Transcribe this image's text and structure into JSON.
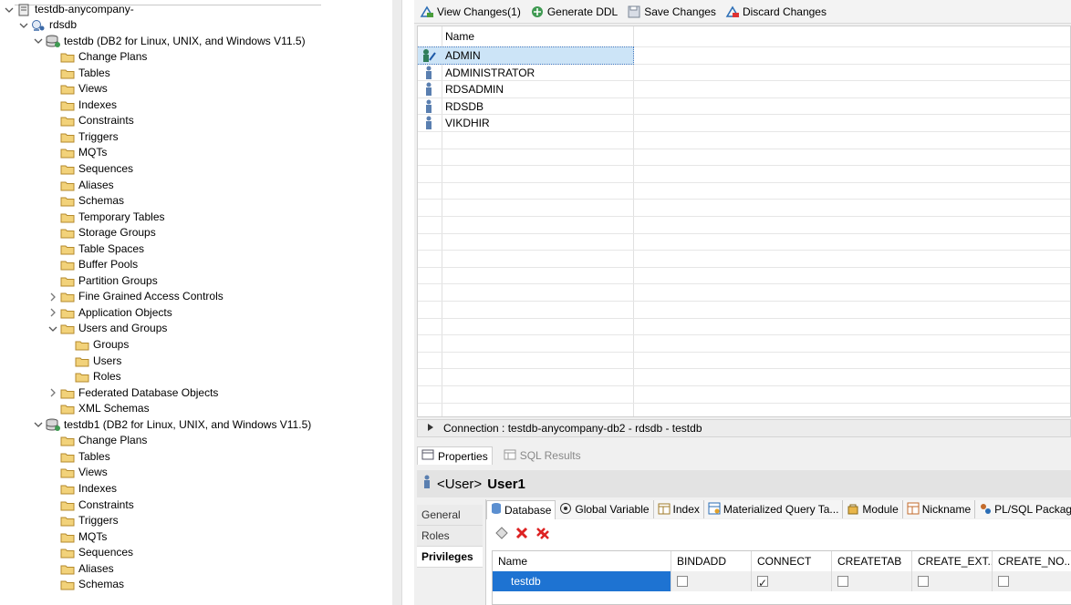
{
  "tree": {
    "nodes": [
      {
        "label": "testdb-anycompany-",
        "icon": "server-icon",
        "twisty": "open"
      },
      {
        "label": "rdsdb",
        "icon": "instance-icon",
        "twisty": "open"
      },
      {
        "label": "testdb (DB2 for Linux, UNIX, and Windows V11.5)",
        "icon": "database-icon",
        "twisty": "open"
      },
      {
        "label": "Change Plans",
        "icon": "folder-icon",
        "twisty": "none"
      },
      {
        "label": "Tables",
        "icon": "folder-icon",
        "twisty": "none"
      },
      {
        "label": "Views",
        "icon": "folder-icon",
        "twisty": "none"
      },
      {
        "label": "Indexes",
        "icon": "folder-icon",
        "twisty": "none"
      },
      {
        "label": "Constraints",
        "icon": "folder-icon",
        "twisty": "none"
      },
      {
        "label": "Triggers",
        "icon": "folder-icon",
        "twisty": "none"
      },
      {
        "label": "MQTs",
        "icon": "folder-icon",
        "twisty": "none"
      },
      {
        "label": "Sequences",
        "icon": "folder-icon",
        "twisty": "none"
      },
      {
        "label": "Aliases",
        "icon": "folder-icon",
        "twisty": "none"
      },
      {
        "label": "Schemas",
        "icon": "folder-icon",
        "twisty": "none"
      },
      {
        "label": "Temporary Tables",
        "icon": "folder-icon",
        "twisty": "none"
      },
      {
        "label": "Storage Groups",
        "icon": "folder-icon",
        "twisty": "none"
      },
      {
        "label": "Table Spaces",
        "icon": "folder-icon",
        "twisty": "none"
      },
      {
        "label": "Buffer Pools",
        "icon": "folder-icon",
        "twisty": "none"
      },
      {
        "label": "Partition Groups",
        "icon": "folder-icon",
        "twisty": "none"
      },
      {
        "label": "Fine Grained Access Controls",
        "icon": "folder-icon",
        "twisty": "closed"
      },
      {
        "label": "Application Objects",
        "icon": "folder-icon",
        "twisty": "closed"
      },
      {
        "label": "Users and Groups",
        "icon": "folder-icon",
        "twisty": "open"
      },
      {
        "label": "Groups",
        "icon": "folder-icon",
        "twisty": "none"
      },
      {
        "label": "Users",
        "icon": "folder-icon",
        "twisty": "none"
      },
      {
        "label": "Roles",
        "icon": "folder-icon",
        "twisty": "none"
      },
      {
        "label": "Federated Database Objects",
        "icon": "folder-icon",
        "twisty": "closed"
      },
      {
        "label": "XML Schemas",
        "icon": "folder-icon",
        "twisty": "none"
      },
      {
        "label": "testdb1 (DB2 for Linux, UNIX, and Windows V11.5)",
        "icon": "database-icon",
        "twisty": "open"
      },
      {
        "label": "Change Plans",
        "icon": "folder-icon",
        "twisty": "none"
      },
      {
        "label": "Tables",
        "icon": "folder-icon",
        "twisty": "none"
      },
      {
        "label": "Views",
        "icon": "folder-icon",
        "twisty": "none"
      },
      {
        "label": "Indexes",
        "icon": "folder-icon",
        "twisty": "none"
      },
      {
        "label": "Constraints",
        "icon": "folder-icon",
        "twisty": "none"
      },
      {
        "label": "Triggers",
        "icon": "folder-icon",
        "twisty": "none"
      },
      {
        "label": "MQTs",
        "icon": "folder-icon",
        "twisty": "none"
      },
      {
        "label": "Sequences",
        "icon": "folder-icon",
        "twisty": "none"
      },
      {
        "label": "Aliases",
        "icon": "folder-icon",
        "twisty": "none"
      },
      {
        "label": "Schemas",
        "icon": "folder-icon",
        "twisty": "none"
      }
    ]
  },
  "toolbar": {
    "view_changes": "View Changes(1)",
    "generate_ddl": "Generate DDL",
    "save_changes": "Save Changes",
    "discard_changes": "Discard Changes"
  },
  "users_grid": {
    "column_header": "Name",
    "rows": [
      {
        "name": "ADMIN",
        "icon": "user-edit-icon",
        "selected": true
      },
      {
        "name": "ADMINISTRATOR",
        "icon": "user-icon",
        "selected": false
      },
      {
        "name": "RDSADMIN",
        "icon": "user-icon",
        "selected": false
      },
      {
        "name": "RDSDB",
        "icon": "user-icon",
        "selected": false
      },
      {
        "name": "VIKDHIR",
        "icon": "user-icon",
        "selected": false
      }
    ]
  },
  "connection": {
    "label": "Connection : testdb-anycompany-db2 - rdsdb - testdb"
  },
  "properties": {
    "tabs": [
      "Properties",
      "SQL Results"
    ],
    "title_type": "<User>",
    "title_name": "User1",
    "side_tabs": [
      "General",
      "Roles",
      "Privileges"
    ],
    "priv_tabs": [
      "Database",
      "Global Variable",
      "Index",
      "Materialized Query Ta...",
      "Module",
      "Nickname",
      "PL/SQL Package"
    ],
    "table": {
      "headers": [
        "Name",
        "BINDADD",
        "CONNECT",
        "CREATETAB",
        "CREATE_EXT...",
        "CREATE_NO..."
      ],
      "row": {
        "name": "testdb",
        "checks": [
          false,
          true,
          false,
          false,
          false
        ]
      }
    }
  },
  "colors": {
    "selection": "#cce4f7",
    "row_select_blue": "#1e73d2",
    "folder": "#e8c66c"
  }
}
